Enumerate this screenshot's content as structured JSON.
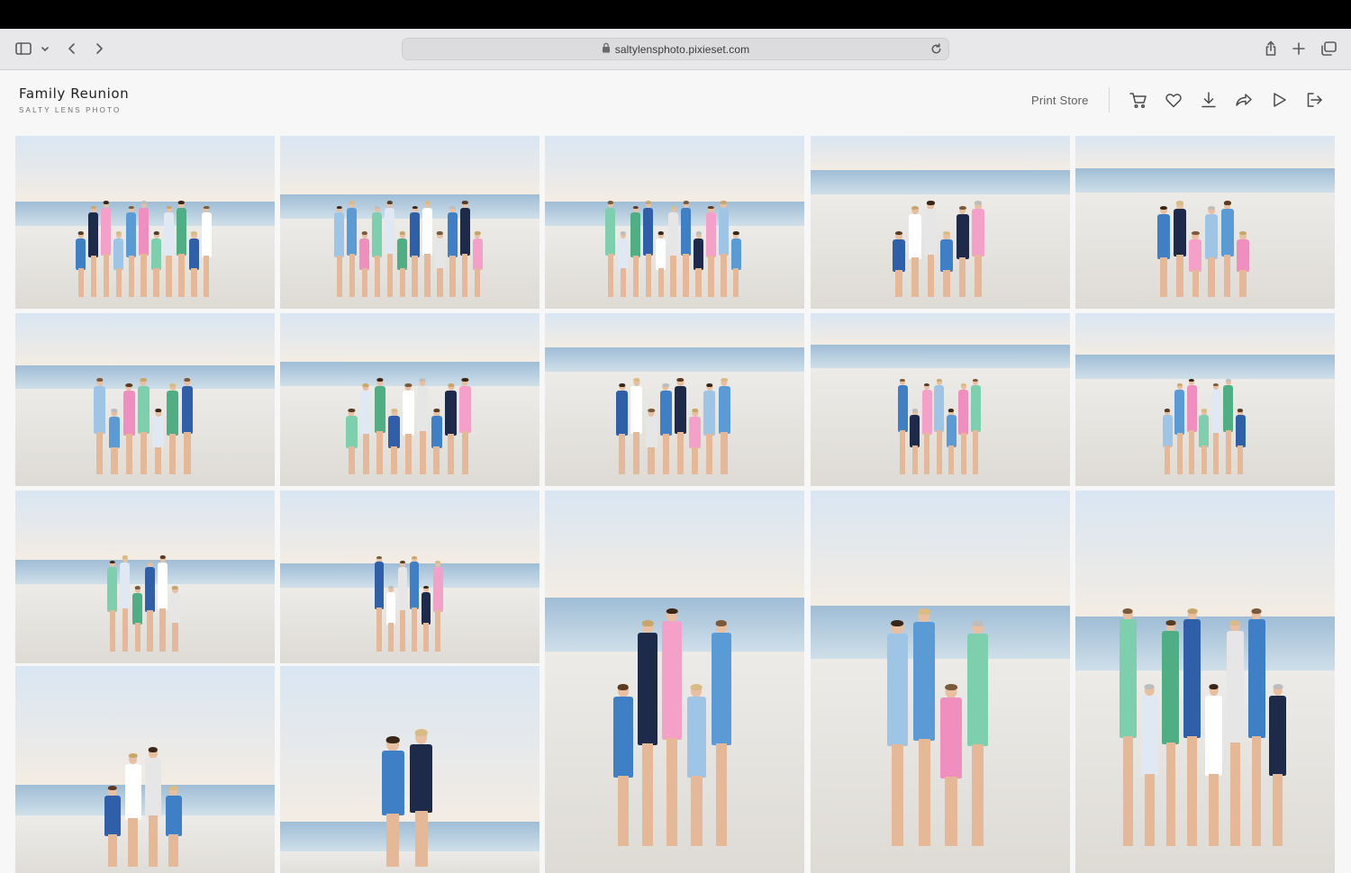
{
  "browser": {
    "url": "saltylensphoto.pixieset.com",
    "icons": [
      "sidebar-icon",
      "chevron-down-icon",
      "back-icon",
      "forward-icon",
      "lock-icon",
      "reload-icon",
      "share-icon",
      "new-tab-icon",
      "tabs-overview-icon"
    ]
  },
  "gallery": {
    "title": "Family Reunion",
    "subtitle": "SALTY LENS PHOTO",
    "print_store_label": "Print Store",
    "actions": [
      "cart-icon",
      "heart-icon",
      "download-icon",
      "share-icon",
      "slideshow-icon",
      "exit-icon"
    ]
  },
  "colors": {
    "accent_text": "#1f1f1f",
    "page_bg": "#f7f7f7",
    "sky": "#dbe6f1",
    "sea": "#b9cfe1",
    "sand": "#e7e4df"
  },
  "photos": [
    {
      "scene": "group-large"
    },
    {
      "scene": "group-large-cheer"
    },
    {
      "scene": "group-large"
    },
    {
      "scene": "kids-group"
    },
    {
      "scene": "women-group"
    },
    {
      "scene": "kids-grandparents"
    },
    {
      "scene": "adults-group"
    },
    {
      "scene": "men-with-kids"
    },
    {
      "scene": "walking-away"
    },
    {
      "scene": "walking-toward"
    },
    {
      "scene": "walking-away"
    },
    {
      "scene": "walking-toward"
    },
    {
      "scene": "family-portrait"
    },
    {
      "scene": "family-portrait"
    },
    {
      "scene": "women-group"
    },
    {
      "scene": "family-portrait"
    },
    {
      "scene": "couple-portrait"
    }
  ]
}
